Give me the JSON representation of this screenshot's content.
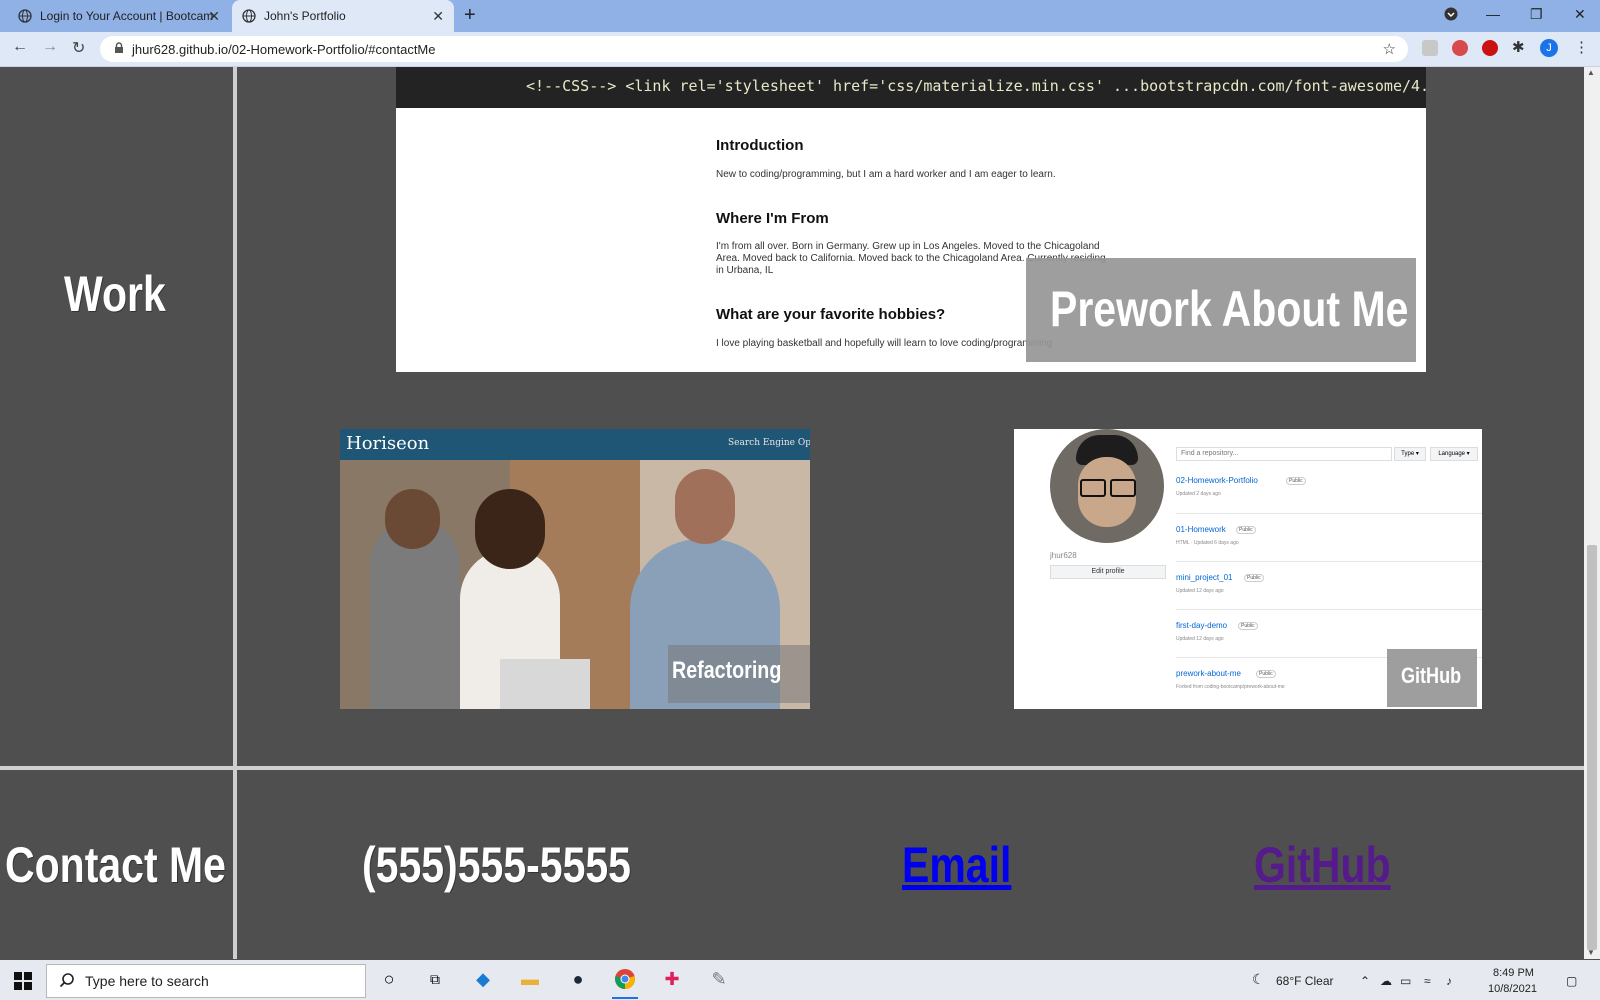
{
  "browser": {
    "tabs": [
      {
        "title": "Login to Your Account | Bootcam"
      },
      {
        "title": "John's Portfolio"
      }
    ],
    "url": "jhur628.github.io/02-Homework-Portfolio/#contactMe"
  },
  "page": {
    "work_title": "Work",
    "prework": {
      "code_snippet": "<!--CSS-->   <link rel='stylesheet' href='css/materialize.min.css'   ...bootstrapcdn.com/font-awesome/4.",
      "intro_heading": "Introduction",
      "intro_text": "New to coding/programming, but I am a hard worker and I am eager to learn.",
      "from_heading": "Where I'm From",
      "from_text": "I'm from all over. Born in Germany. Grew up in Los Angeles. Moved to the Chicagoland Area. Moved back to California. Moved back to the Chicagoland Area. Currently residing in Urbana, IL",
      "hobbies_heading": "What are your favorite hobbies?",
      "hobbies_text": "I love playing basketball and hopefully will learn to love coding/programming",
      "overlay_label": "Prework About Me"
    },
    "refactoring": {
      "logo": "Horiseon",
      "seo_text": "Search Engine Optimiza",
      "overlay_label": "Refactoring"
    },
    "github_card": {
      "find_placeholder": "Find a repository...",
      "type_label": "Type ▾",
      "language_label": "Language ▾",
      "username": "jhur628",
      "edit_profile": "Edit profile",
      "repos": [
        {
          "name": "02-Homework-Portfolio",
          "badge": "Public",
          "meta": "Updated 2 days ago"
        },
        {
          "name": "01-Homework",
          "badge": "Public",
          "meta": "HTML · Updated 6 days ago"
        },
        {
          "name": "mini_project_01",
          "badge": "Public",
          "meta": "Updated 12 days ago"
        },
        {
          "name": "first-day-demo",
          "badge": "Public",
          "meta": "Updated 12 days ago"
        },
        {
          "name": "prework-about-me",
          "badge": "Public",
          "meta": "Forked from coding-bootcamp/prework-about-me"
        }
      ],
      "overlay_label": "GitHub"
    },
    "contact": {
      "title": "Contact Me",
      "phone": "(555)555-5555",
      "email_label": "Email",
      "github_label": "GitHub"
    }
  },
  "taskbar": {
    "search_placeholder": "Type here to search",
    "weather": "68°F  Clear",
    "time": "8:49 PM",
    "date": "10/8/2021"
  },
  "colors": {
    "page_bg": "#4f4f4f",
    "tab_strip": "#8fb1e6",
    "toolbar": "#dfe8f7",
    "link_blue": "#0000ee",
    "link_visited": "#551a8b"
  }
}
